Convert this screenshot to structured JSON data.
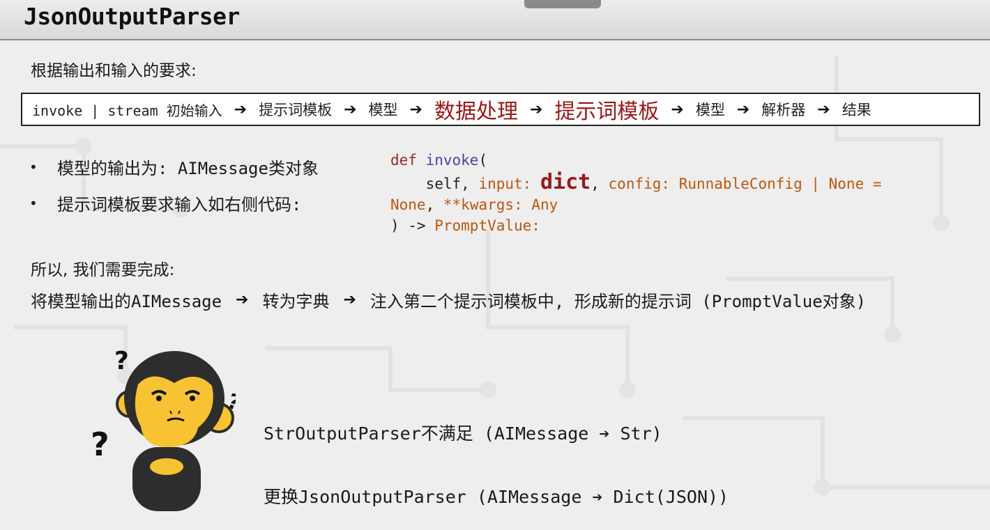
{
  "slide": {
    "title": "JsonOutputParser"
  },
  "requirement_label": "根据输出和输入的要求:",
  "flow": [
    {
      "text": "invoke | stream 初始输入",
      "style": "normal"
    },
    {
      "text": "提示词模板",
      "style": "normal"
    },
    {
      "text": "模型",
      "style": "normal"
    },
    {
      "text": "数据处理",
      "style": "highlight"
    },
    {
      "text": "提示词模板",
      "style": "highlight"
    },
    {
      "text": "模型",
      "style": "normal"
    },
    {
      "text": "解析器",
      "style": "normal"
    },
    {
      "text": "结果",
      "style": "normal"
    }
  ],
  "arrow_glyph": "➔",
  "bullets": [
    "模型的输出为: AIMessage类对象",
    "提示词模板要求输入如右侧代码:"
  ],
  "code": {
    "def_kw": "def",
    "fn_name": "invoke",
    "open_paren": "(",
    "self_token": "self,",
    "input_param": "input:",
    "input_type": "dict",
    "comma": ",",
    "config_param": "config:",
    "config_type": "RunnableConfig | None =",
    "none_val": "None",
    "comma2": ",",
    "kwargs_param": "**kwargs:",
    "kwargs_type": "Any",
    "close_arrow": ") ->",
    "return_type": "PromptValue:"
  },
  "so_label": "所以, 我们需要完成:",
  "steps": [
    "将模型输出的AIMessage",
    "转为字典",
    "注入第二个提示词模板中, 形成新的提示词 (PromptValue对象)"
  ],
  "notes": [
    "StrOutputParser不满足 (AIMessage ➔ Str)",
    "更换JsonOutputParser (AIMessage ➔ Dict(JSON))"
  ],
  "colors": {
    "highlight": "#9a1818",
    "keyword": "#9a2a2a",
    "function": "#5a3aa8",
    "param": "#c0560c",
    "monkey_face": "#f7c332",
    "monkey_fur": "#2d2d2d"
  }
}
